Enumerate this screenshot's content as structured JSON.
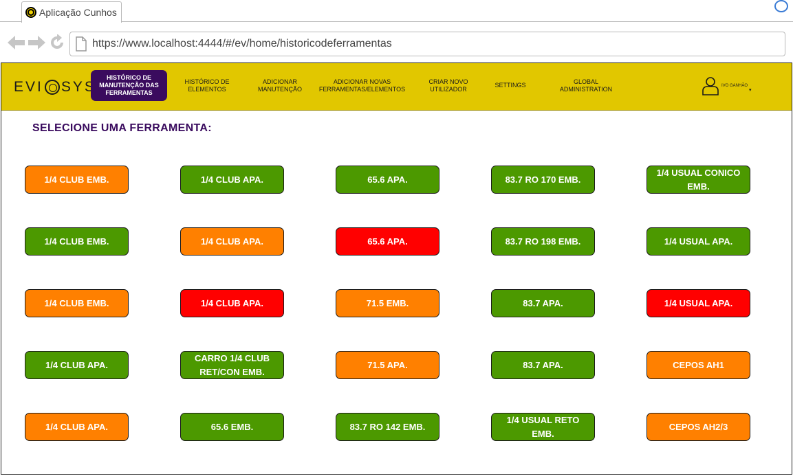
{
  "browser": {
    "tab_title": "Aplicação Cunhos",
    "url": "https://www.localhost:4444/#/ev/home/historicodeferramentas"
  },
  "app": {
    "logo_text_left": "EVI",
    "logo_text_right": "SYS",
    "nav": [
      {
        "label": "HISTÓRICO DE MANUTENÇÃO DAS FERRAMENTAS",
        "active": true
      },
      {
        "label": "HISTÓRICO DE ELEMENTOS",
        "active": false
      },
      {
        "label": "ADICIONAR MANUTENÇÃO",
        "active": false
      },
      {
        "label": "ADICIONAR NOVAS FERRAMENTAS/ELEMENTOS",
        "active": false
      },
      {
        "label": "CRIAR NOVO UTILIZADOR",
        "active": false
      },
      {
        "label": "SETTINGS",
        "active": false
      },
      {
        "label": "GLOBAL ADMINISTRATION",
        "active": false
      }
    ],
    "user": {
      "name": "IVO GANHÃO",
      "caret": "▾"
    },
    "page_title": "SELECIONE UMA FERRAMENTA:"
  },
  "colors": {
    "navbar": "#e1c700",
    "active_nav": "#3a0b5e",
    "green": "#4c9900",
    "orange": "#ff8000",
    "red": "#ff0000"
  },
  "tools": [
    [
      {
        "label": "1/4 CLUB EMB.",
        "status": "orange"
      },
      {
        "label": "1/4 CLUB APA.",
        "status": "green"
      },
      {
        "label": "65.6 APA.",
        "status": "green"
      },
      {
        "label": "83.7 RO 170 EMB.",
        "status": "green"
      },
      {
        "label": "1/4 USUAL CONICO EMB.",
        "status": "green"
      }
    ],
    [
      {
        "label": "1/4 CLUB EMB.",
        "status": "green"
      },
      {
        "label": "1/4 CLUB APA.",
        "status": "orange"
      },
      {
        "label": "65.6 APA.",
        "status": "red"
      },
      {
        "label": "83.7 RO 198 EMB.",
        "status": "green"
      },
      {
        "label": "1/4 USUAL APA.",
        "status": "green"
      }
    ],
    [
      {
        "label": "1/4 CLUB EMB.",
        "status": "orange"
      },
      {
        "label": "1/4 CLUB APA.",
        "status": "red"
      },
      {
        "label": "71.5 EMB.",
        "status": "orange"
      },
      {
        "label": "83.7 APA.",
        "status": "green"
      },
      {
        "label": "1/4 USUAL APA.",
        "status": "red"
      }
    ],
    [
      {
        "label": "1/4 CLUB APA.",
        "status": "green"
      },
      {
        "label": "CARRO 1/4 CLUB RET/CON EMB.",
        "status": "green"
      },
      {
        "label": "71.5 APA.",
        "status": "orange"
      },
      {
        "label": "83.7 APA.",
        "status": "green"
      },
      {
        "label": "CEPOS AH1",
        "status": "orange"
      }
    ],
    [
      {
        "label": "1/4 CLUB APA.",
        "status": "orange"
      },
      {
        "label": "65.6 EMB.",
        "status": "green"
      },
      {
        "label": "83.7 RO 142 EMB.",
        "status": "green"
      },
      {
        "label": "1/4 USUAL RETO EMB.",
        "status": "green"
      },
      {
        "label": "CEPOS AH2/3",
        "status": "orange"
      }
    ]
  ]
}
